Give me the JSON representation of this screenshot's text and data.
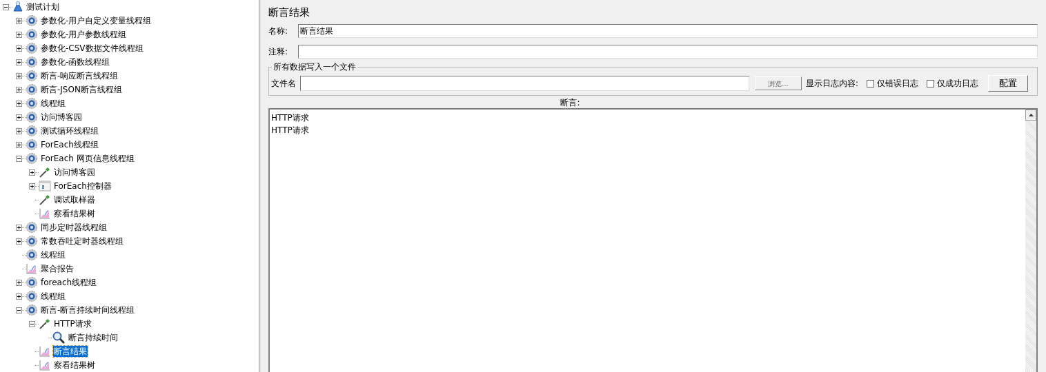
{
  "tree": [
    {
      "label": "测试计划",
      "kind": "plan",
      "expanded": true,
      "selected": false,
      "children": [
        {
          "label": "参数化-用户自定义变量线程组",
          "kind": "thread-group",
          "expanded": false,
          "selected": false
        },
        {
          "label": "参数化-用户参数线程组",
          "kind": "thread-group",
          "expanded": false,
          "selected": false
        },
        {
          "label": "参数化-CSV数据文件线程组",
          "kind": "thread-group",
          "expanded": false,
          "selected": false
        },
        {
          "label": "参数化-函数线程组",
          "kind": "thread-group",
          "expanded": false,
          "selected": false
        },
        {
          "label": "断言-响应断言线程组",
          "kind": "thread-group",
          "expanded": false,
          "selected": false
        },
        {
          "label": "断言-JSON断言线程组",
          "kind": "thread-group",
          "expanded": false,
          "selected": false
        },
        {
          "label": "线程组",
          "kind": "thread-group",
          "expanded": false,
          "selected": false
        },
        {
          "label": "访问博客园",
          "kind": "thread-group",
          "expanded": false,
          "selected": false
        },
        {
          "label": "测试循环线程组",
          "kind": "thread-group",
          "expanded": false,
          "selected": false
        },
        {
          "label": "ForEach线程组",
          "kind": "thread-group",
          "expanded": false,
          "selected": false
        },
        {
          "label": "ForEach 网页信息线程组",
          "kind": "thread-group",
          "expanded": true,
          "selected": false,
          "children": [
            {
              "label": "访问博客园",
              "kind": "sampler",
              "expanded": false,
              "selected": false
            },
            {
              "label": "ForEach控制器",
              "kind": "controller",
              "expanded": false,
              "selected": false
            },
            {
              "label": "调试取样器",
              "kind": "sampler",
              "selected": false
            },
            {
              "label": "察看结果树",
              "kind": "listener",
              "selected": false
            }
          ]
        },
        {
          "label": "同步定时器线程组",
          "kind": "thread-group",
          "expanded": false,
          "selected": false
        },
        {
          "label": "常数吞吐定时器线程组",
          "kind": "thread-group",
          "expanded": false,
          "selected": false
        },
        {
          "label": "线程组",
          "kind": "thread-group",
          "selected": false
        },
        {
          "label": "聚合报告",
          "kind": "listener",
          "selected": false
        },
        {
          "label": "foreach线程组",
          "kind": "thread-group",
          "expanded": false,
          "selected": false
        },
        {
          "label": "线程组",
          "kind": "thread-group",
          "expanded": false,
          "selected": false
        },
        {
          "label": "断言-断言持续时间线程组",
          "kind": "thread-group",
          "expanded": true,
          "selected": false,
          "children": [
            {
              "label": "HTTP请求",
              "kind": "sampler",
              "expanded": true,
              "selected": false,
              "children": [
                {
                  "label": "断言持续时间",
                  "kind": "assertion",
                  "selected": false
                }
              ]
            },
            {
              "label": "断言结果",
              "kind": "listener",
              "selected": true
            },
            {
              "label": "察看结果树",
              "kind": "listener",
              "selected": false
            }
          ]
        }
      ]
    }
  ],
  "panel": {
    "title": "断言结果",
    "name": {
      "label": "名称:",
      "value": "断言结果"
    },
    "comment": {
      "label": "注释:"
    },
    "file_group": {
      "legend": "所有数据写入一个文件",
      "file_label": "文件名",
      "browse_button": "浏览...",
      "log_label": "显示日志内容:",
      "checkboxes": [
        {
          "label": "仅错误日志",
          "checked": false
        },
        {
          "label": "仅成功日志",
          "checked": false
        }
      ],
      "config_button": "配置"
    },
    "assertions": {
      "label": "断言:",
      "lines": [
        "HTTP请求",
        "HTTP请求"
      ]
    }
  }
}
